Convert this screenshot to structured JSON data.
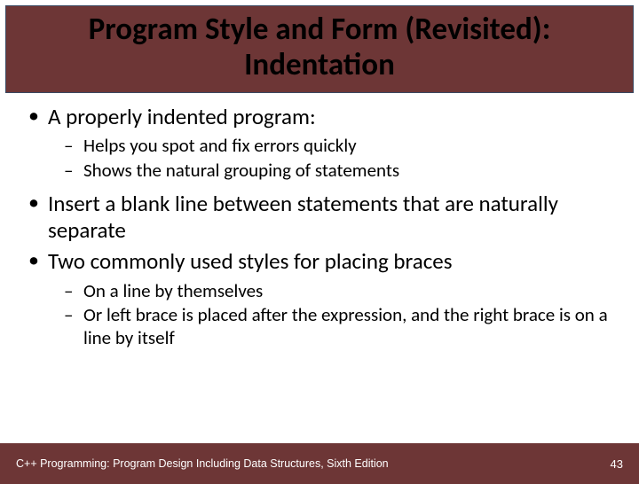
{
  "title": "Program Style and Form (Revisited): Indentation",
  "bullets": {
    "b1": "A properly indented program:",
    "b1_sub1": "Helps you spot and fix errors quickly",
    "b1_sub2": "Shows the natural grouping of statements",
    "b2": "Insert a blank line between statements that are naturally separate",
    "b3": "Two commonly used styles for placing braces",
    "b3_sub1": "On a line by themselves",
    "b3_sub2": "Or left brace is placed after the expression, and the right brace is on a line by itself"
  },
  "footer": {
    "source": "C++ Programming: Program Design Including Data Structures, Sixth Edition",
    "page": "43"
  }
}
